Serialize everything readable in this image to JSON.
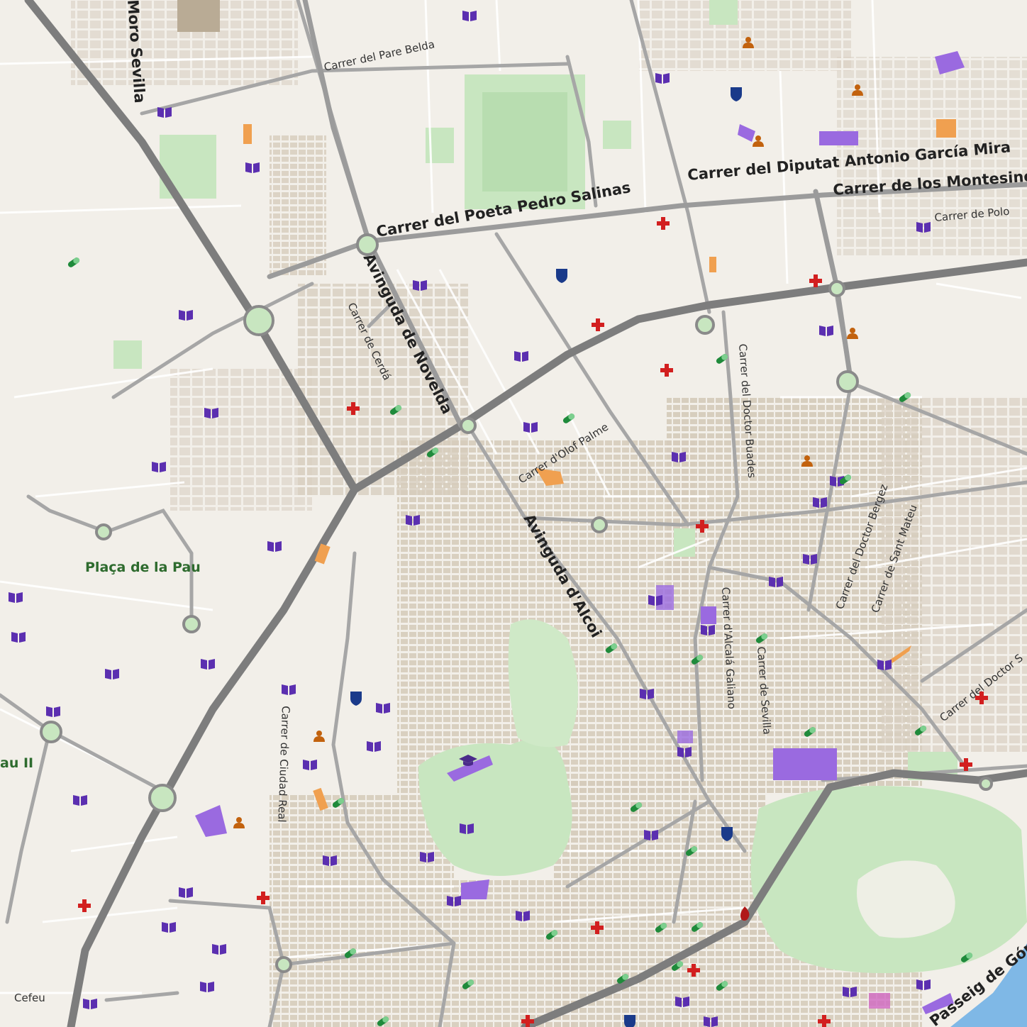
{
  "map": {
    "colors": {
      "land": "#f2efe9",
      "park": "#c8e6c0",
      "park_dark": "#add9a5",
      "building": "#d9d0c2",
      "road_major": "#8a8a8a",
      "road_mid": "#a6a6a6",
      "road_minor": "#ffffff",
      "water": "#7fb8e6",
      "library": "#5b2fb0",
      "pharmacy": "#1f8a3b",
      "hospital": "#d21f1f",
      "police": "#1a3a8a",
      "social": "#c2620e",
      "orange_area": "#f0a050",
      "purple_area": "#9a6ae0"
    },
    "labels": {
      "carrer_pare_belda": "Carrer del Pare Belda",
      "moro_sevilla": "Moro Sevilla",
      "poeta_pedro_salinas": "Carrer del Poeta Pedro Salinas",
      "diputat_garcia_mira": "Carrer del Diputat Antonio García Mira",
      "los_montesinos": "Carrer de los Montesinos",
      "carrer_de_polo": "Carrer de Polo",
      "avinguda_novelda": "Avinguda de Novelda",
      "carrer_cerda": "Carrer de Cerdá",
      "olof_palme": "Carrer d'Olof Palme",
      "doctor_buades": "Carrer del Doctor Buades",
      "doctor_bergez": "Carrer del Doctor Bergez",
      "sant_mateu": "Carrer de Sant Mateu",
      "avinguda_alcoi": "Avinguda d'Alcoi",
      "placa_pau": "Plaça de la Pau",
      "pau_ii": "au II",
      "alcala_galiano": "Carrer d'Alcalá Galiano",
      "carrer_sevilla": "Carrer de Sevilla",
      "doctor_sapena": "Carrer del Doctor S",
      "ciudad_real": "Carrer de Ciudad Real",
      "cefeu": "Cefeu",
      "passeig_gomiz": "Passeig de Gómiz"
    },
    "icons": {
      "library": "library-icon",
      "pharmacy": "pharmacy-icon",
      "hospital": "hospital-icon",
      "police": "police-icon",
      "social": "social-facility-icon",
      "university": "university-icon",
      "fire": "fire-station-icon"
    }
  }
}
